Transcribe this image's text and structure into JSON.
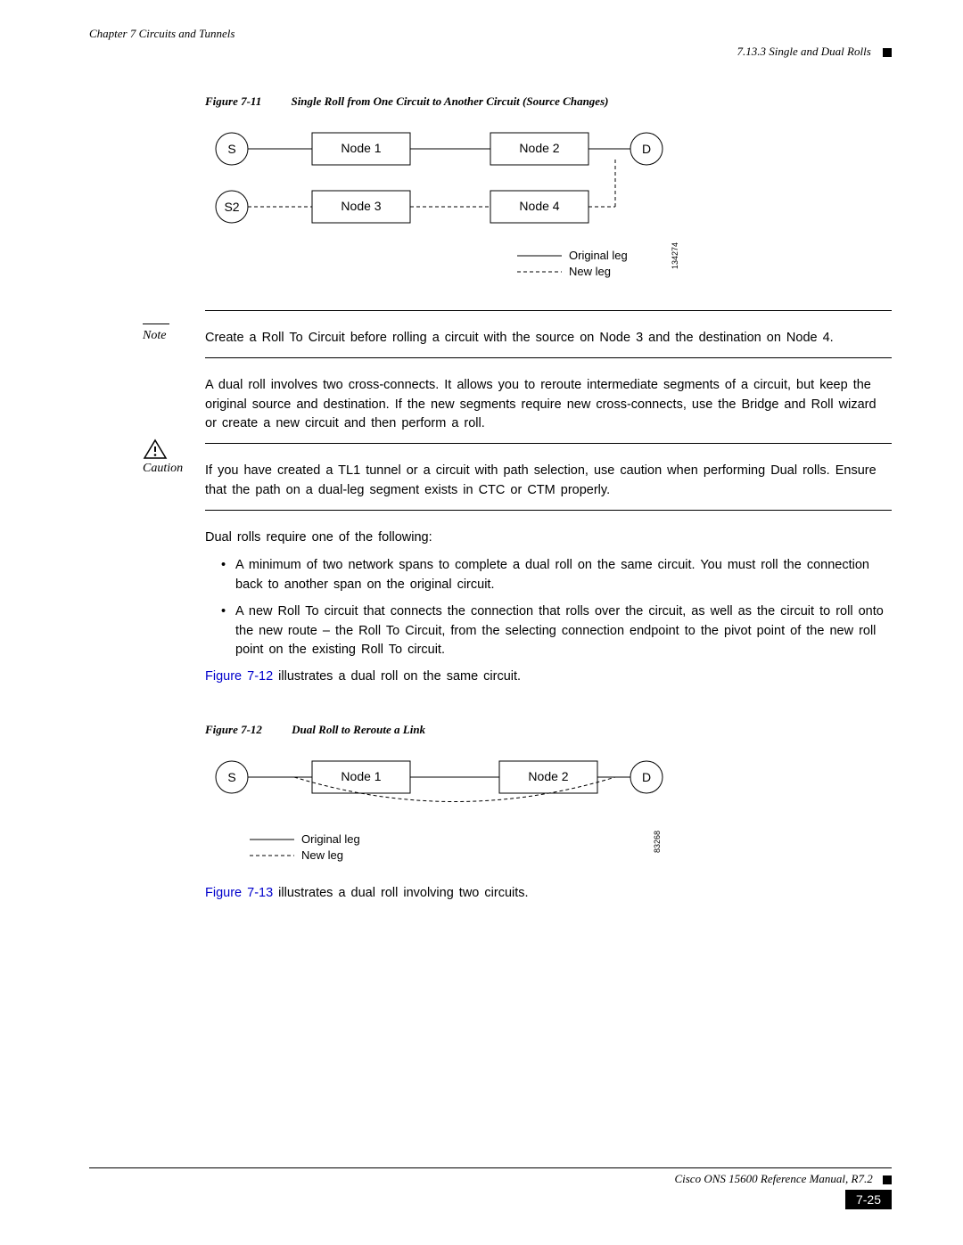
{
  "header": {
    "chapter": "Chapter 7 Circuits and Tunnels",
    "section": "7.13.3  Single and Dual Rolls"
  },
  "fig711": {
    "label": "Figure 7-11",
    "title": "Single Roll from One Circuit to Another Circuit (Source Changes)",
    "nodes": {
      "s": "S",
      "s2": "S2",
      "d": "D",
      "n1": "Node 1",
      "n2": "Node 2",
      "n3": "Node 3",
      "n4": "Node 4"
    },
    "legend": {
      "orig": "Original leg",
      "new": "New leg"
    },
    "id": "134274"
  },
  "note": {
    "label": "Note",
    "text": "Create a Roll To Circuit before rolling a circuit with the source on Node 3 and the destination on Node 4."
  },
  "para1": "A dual roll involves two cross-connects. It allows you to reroute intermediate segments of a circuit, but keep the original source and destination. If the new segments require new cross-connects, use the Bridge and Roll wizard or create a new circuit and then perform a roll.",
  "caution": {
    "label": "Caution",
    "text": "If you have created a TL1 tunnel or a circuit with path selection, use caution when performing Dual rolls. Ensure that the path on a dual-leg segment exists in CTC or CTM properly."
  },
  "para2": "Dual rolls require one of the following:",
  "bullets": [
    "A minimum of two network spans to complete a dual roll on the same circuit. You must roll the connection back to another span on the original circuit.",
    "A new Roll To circuit that connects the connection that rolls over the circuit, as well as the circuit to roll onto the new route – the Roll To Circuit, from the selecting connection endpoint to the pivot point of the new roll point on the existing Roll To circuit."
  ],
  "ref712": "Figure 7-12 illustrates a dual roll on the same circuit.",
  "fig712": {
    "label": "Figure 7-12",
    "title": "Dual Roll to Reroute a Link",
    "nodes": {
      "s": "S",
      "d": "D",
      "n1": "Node 1",
      "n2": "Node 2"
    },
    "legend": {
      "orig": "Original leg",
      "new": "New leg"
    },
    "id": "83268"
  },
  "ref713": "Figure 7-13 illustrates a dual roll involving two circuits.",
  "footer": {
    "manual": "Cisco ONS 15600 Reference Manual, R7.2",
    "page": "7-25"
  }
}
